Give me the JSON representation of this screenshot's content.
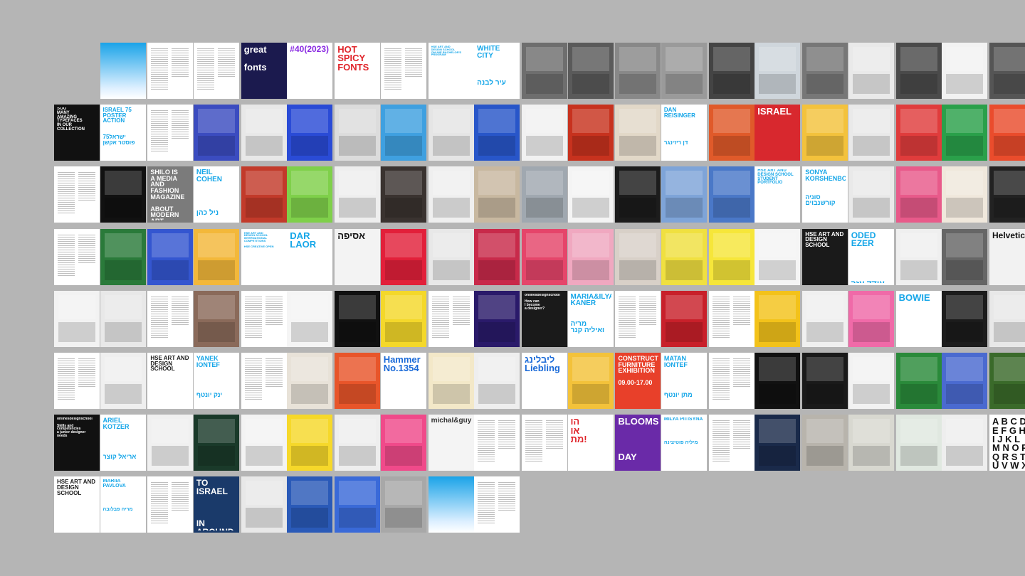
{
  "colors": {
    "background": "#b5b5b5",
    "accent": "#15a6e8",
    "paper": "#ffffff"
  },
  "pages": [
    {
      "id": "0-1",
      "row": 0,
      "col": 1,
      "kind": "blue-gradient"
    },
    {
      "id": "0-2",
      "row": 0,
      "col": 2,
      "kind": "text-spread"
    },
    {
      "id": "0-3",
      "row": 0,
      "col": 3,
      "kind": "text-spread"
    },
    {
      "id": "0-4",
      "row": 0,
      "col": 4,
      "kind": "cover",
      "bg": "#1b1a4e",
      "color": "#ffffff",
      "text": "great\n\nfonts"
    },
    {
      "id": "0-5",
      "row": 0,
      "col": 5,
      "kind": "title",
      "bg": "#ffffff",
      "color": "#8a2be2",
      "text": "#40(2023)"
    },
    {
      "id": "0-6",
      "row": 0,
      "col": 6,
      "kind": "title",
      "bg": "#ffffff",
      "color": "#e0242a",
      "text": "HOT\nSPICY\nFONTS"
    },
    {
      "id": "0-7",
      "row": 0,
      "col": 7,
      "kind": "text-spread"
    },
    {
      "id": "0-8",
      "row": 0,
      "col": 8,
      "kind": "title",
      "bg": "#ffffff",
      "color": "#15a6e8",
      "text": "HSE ART AND\nDESIGN SCHOOL\nONLINE BACHELOR'S PROGRAM"
    },
    {
      "id": "0-9",
      "row": 0,
      "col": 9,
      "kind": "title",
      "bg": "#ffffff",
      "color": "#15a6e8",
      "text": "WHITE CITY\n\n\n\nעיר לבנה"
    },
    {
      "id": "0-10",
      "row": 0,
      "col": 10,
      "kind": "photo",
      "bg": "#6e6e6e"
    },
    {
      "id": "0-11",
      "row": 0,
      "col": 11,
      "kind": "photo",
      "bg": "#5a5a5a"
    },
    {
      "id": "0-12",
      "row": 0,
      "col": 12,
      "kind": "photo",
      "bg": "#888888"
    },
    {
      "id": "0-13",
      "row": 0,
      "col": 13,
      "kind": "photo",
      "bg": "#9a9a9a"
    },
    {
      "id": "0-14",
      "row": 0,
      "col": 14,
      "kind": "photo",
      "bg": "#444444"
    },
    {
      "id": "0-15",
      "row": 0,
      "col": 15,
      "kind": "photo",
      "bg": "#cfd6dc"
    },
    {
      "id": "0-16",
      "row": 0,
      "col": 16,
      "kind": "photo",
      "bg": "#777777"
    },
    {
      "id": "0-17",
      "row": 0,
      "col": 17,
      "kind": "photo",
      "bg": "#e9e9e9"
    },
    {
      "id": "0-18",
      "row": 0,
      "col": 18,
      "kind": "photo",
      "bg": "#4a4a4a"
    },
    {
      "id": "0-19",
      "row": 0,
      "col": 19,
      "kind": "photo",
      "bg": "#f2f2f2"
    },
    {
      "id": "0-20",
      "row": 0,
      "col": 20,
      "kind": "photo",
      "bg": "#555555"
    },
    {
      "id": "1-0",
      "row": 1,
      "col": 0,
      "kind": "title",
      "bg": "#111111",
      "color": "#ffffff",
      "text": "SOO\nMANY\nAMAZING\nTYPEFACES\nIN OUR COLLECTION"
    },
    {
      "id": "1-1",
      "row": 1,
      "col": 1,
      "kind": "title",
      "bg": "#ffffff",
      "color": "#15a6e8",
      "text": "ISRAEL 75\nPOSTER ACTION\n\n\nישראל75\nפוסטר אקשן"
    },
    {
      "id": "1-2",
      "row": 1,
      "col": 2,
      "kind": "text-spread"
    },
    {
      "id": "1-3",
      "row": 1,
      "col": 3,
      "kind": "photo",
      "bg": "#3b4cc0"
    },
    {
      "id": "1-4",
      "row": 1,
      "col": 4,
      "kind": "photo",
      "bg": "#e8e8e8"
    },
    {
      "id": "1-5",
      "row": 1,
      "col": 5,
      "kind": "photo",
      "bg": "#2a4bd6"
    },
    {
      "id": "1-6",
      "row": 1,
      "col": 6,
      "kind": "photo",
      "bg": "#dcdcdc"
    },
    {
      "id": "1-7",
      "row": 1,
      "col": 7,
      "kind": "photo",
      "bg": "#3fa0e0"
    },
    {
      "id": "1-8",
      "row": 1,
      "col": 8,
      "kind": "photo",
      "bg": "#e5e5e5"
    },
    {
      "id": "1-9",
      "row": 1,
      "col": 9,
      "kind": "photo",
      "bg": "#2856c9"
    },
    {
      "id": "1-10",
      "row": 1,
      "col": 10,
      "kind": "photo",
      "bg": "#f1f1f1"
    },
    {
      "id": "1-11",
      "row": 1,
      "col": 11,
      "kind": "photo",
      "bg": "#c7321e"
    },
    {
      "id": "1-12",
      "row": 1,
      "col": 12,
      "kind": "photo",
      "bg": "#e2d8c8"
    },
    {
      "id": "1-13",
      "row": 1,
      "col": 13,
      "kind": "title",
      "bg": "#ffffff",
      "color": "#15a6e8",
      "text": "DAN REISINGER\n\n\n\n\nדן ריזינגר"
    },
    {
      "id": "1-14",
      "row": 1,
      "col": 14,
      "kind": "photo",
      "bg": "#e05a2a"
    },
    {
      "id": "1-15",
      "row": 1,
      "col": 15,
      "kind": "title",
      "bg": "#d8282e",
      "color": "#ffffff",
      "text": "ISRAEL"
    },
    {
      "id": "1-16",
      "row": 1,
      "col": 16,
      "kind": "photo",
      "bg": "#f3c23c"
    },
    {
      "id": "1-17",
      "row": 1,
      "col": 17,
      "kind": "photo",
      "bg": "#e9e9e9"
    },
    {
      "id": "1-18",
      "row": 1,
      "col": 18,
      "kind": "photo",
      "bg": "#e03c3c"
    },
    {
      "id": "1-19",
      "row": 1,
      "col": 19,
      "kind": "photo",
      "bg": "#2aa04a"
    },
    {
      "id": "1-20",
      "row": 1,
      "col": 20,
      "kind": "photo",
      "bg": "#ea4c2c"
    },
    {
      "id": "2-0",
      "row": 2,
      "col": 0,
      "kind": "text-spread"
    },
    {
      "id": "2-1",
      "row": 2,
      "col": 1,
      "kind": "photo",
      "bg": "#111111"
    },
    {
      "id": "2-2",
      "row": 2,
      "col": 2,
      "kind": "title",
      "bg": "#7b7b7b",
      "color": "#ffffff",
      "text": "SHILO IS\nA MEDIA AND\nFASHION\nMAGAZINE\n\nABOUT\nMODERN ART\nIN SAINT\nPETERSBURG"
    },
    {
      "id": "2-3",
      "row": 2,
      "col": 3,
      "kind": "title",
      "bg": "#ffffff",
      "color": "#15a6e8",
      "text": "NEIL COHEN\n\n\n\n\nניל כהן"
    },
    {
      "id": "2-4",
      "row": 2,
      "col": 4,
      "kind": "photo",
      "bg": "#c23a2a"
    },
    {
      "id": "2-5",
      "row": 2,
      "col": 5,
      "kind": "photo",
      "bg": "#7fd04a"
    },
    {
      "id": "2-6",
      "row": 2,
      "col": 6,
      "kind": "photo",
      "bg": "#eeeeee"
    },
    {
      "id": "2-7",
      "row": 2,
      "col": 7,
      "kind": "photo",
      "bg": "#3a3330"
    },
    {
      "id": "2-8",
      "row": 2,
      "col": 8,
      "kind": "photo",
      "bg": "#efefef"
    },
    {
      "id": "2-9",
      "row": 2,
      "col": 9,
      "kind": "photo",
      "bg": "#c8b8a0"
    },
    {
      "id": "2-10",
      "row": 2,
      "col": 10,
      "kind": "photo",
      "bg": "#a0a8b0"
    },
    {
      "id": "2-11",
      "row": 2,
      "col": 11,
      "kind": "photo",
      "bg": "#f4f4f4"
    },
    {
      "id": "2-12",
      "row": 2,
      "col": 12,
      "kind": "photo",
      "bg": "#1c1c1c"
    },
    {
      "id": "2-13",
      "row": 2,
      "col": 13,
      "kind": "photo",
      "bg": "#7ea4d8"
    },
    {
      "id": "2-14",
      "row": 2,
      "col": 14,
      "kind": "photo",
      "bg": "#4a78c8"
    },
    {
      "id": "2-15",
      "row": 2,
      "col": 15,
      "kind": "title",
      "bg": "#ffffff",
      "color": "#15a6e8",
      "text": "HSE ART AND\nDESIGN SCHOOL\nSTUDENT PORTFOLIO"
    },
    {
      "id": "2-16",
      "row": 2,
      "col": 16,
      "kind": "title",
      "bg": "#ffffff",
      "color": "#15a6e8",
      "text": "SONYA\nKORSHENBOYM\n\n\nסוניה\nקורשנבוים"
    },
    {
      "id": "2-17",
      "row": 2,
      "col": 17,
      "kind": "photo",
      "bg": "#e9e9e9"
    },
    {
      "id": "2-18",
      "row": 2,
      "col": 18,
      "kind": "photo",
      "bg": "#e85a8a"
    },
    {
      "id": "2-19",
      "row": 2,
      "col": 19,
      "kind": "photo",
      "bg": "#f0e8dc"
    },
    {
      "id": "2-20",
      "row": 2,
      "col": 20,
      "kind": "photo",
      "bg": "#222222"
    },
    {
      "id": "3-0",
      "row": 3,
      "col": 0,
      "kind": "text-spread"
    },
    {
      "id": "3-1",
      "row": 3,
      "col": 1,
      "kind": "photo",
      "bg": "#2a7a3a"
    },
    {
      "id": "3-2",
      "row": 3,
      "col": 2,
      "kind": "photo",
      "bg": "#3456d0"
    },
    {
      "id": "3-3",
      "row": 3,
      "col": 3,
      "kind": "photo",
      "bg": "#f3b83a"
    },
    {
      "id": "3-4",
      "row": 3,
      "col": 4,
      "kind": "title",
      "bg": "#ffffff",
      "color": "#15a6e8",
      "text": "HSE ART AND\nDESIGN SCHOOL\nINTERNATIONAL COMPETITIONS\n\nHSE CREATIVE OPEN"
    },
    {
      "id": "3-5",
      "row": 3,
      "col": 5,
      "kind": "title",
      "bg": "#ffffff",
      "color": "#15a6e8",
      "text": "DAR LAOR\n\n\n\n\nדר לאור"
    },
    {
      "id": "3-6",
      "row": 3,
      "col": 6,
      "kind": "title",
      "bg": "#f3f3f3",
      "color": "#111111",
      "text": "אסיפה"
    },
    {
      "id": "3-7",
      "row": 3,
      "col": 7,
      "kind": "photo",
      "bg": "#e2203a"
    },
    {
      "id": "3-8",
      "row": 3,
      "col": 8,
      "kind": "photo",
      "bg": "#e8e8e8"
    },
    {
      "id": "3-9",
      "row": 3,
      "col": 9,
      "kind": "photo",
      "bg": "#c82a4a"
    },
    {
      "id": "3-10",
      "row": 3,
      "col": 10,
      "kind": "photo",
      "bg": "#e5456a"
    },
    {
      "id": "3-11",
      "row": 3,
      "col": 11,
      "kind": "photo",
      "bg": "#f0a8c0"
    },
    {
      "id": "3-12",
      "row": 3,
      "col": 12,
      "kind": "photo",
      "bg": "#d8d0c8"
    },
    {
      "id": "3-13",
      "row": 3,
      "col": 13,
      "kind": "photo",
      "bg": "#f0e040"
    },
    {
      "id": "3-14",
      "row": 3,
      "col": 14,
      "kind": "photo",
      "bg": "#f6e63a"
    },
    {
      "id": "3-15",
      "row": 3,
      "col": 15,
      "kind": "photo",
      "bg": "#f5f5f5"
    },
    {
      "id": "3-16",
      "row": 3,
      "col": 16,
      "kind": "title",
      "bg": "#1a1a1a",
      "color": "#ffffff",
      "text": "HSE ART AND\nDESIGN SCHOOL"
    },
    {
      "id": "3-17",
      "row": 3,
      "col": 17,
      "kind": "title",
      "bg": "#ffffff",
      "color": "#15a6e8",
      "text": "ODED EZER\n\n\n\n\nעודד עזר"
    },
    {
      "id": "3-18",
      "row": 3,
      "col": 18,
      "kind": "photo",
      "bg": "#efefef"
    },
    {
      "id": "3-19",
      "row": 3,
      "col": 19,
      "kind": "photo",
      "bg": "#666666"
    },
    {
      "id": "3-20",
      "row": 3,
      "col": 20,
      "kind": "title",
      "bg": "#f2f2f2",
      "color": "#111111",
      "text": "Helvetica"
    },
    {
      "id": "4-0",
      "row": 4,
      "col": 0,
      "kind": "photo",
      "bg": "#f2f2f2"
    },
    {
      "id": "4-1",
      "row": 4,
      "col": 1,
      "kind": "photo",
      "bg": "#e8e8e8"
    },
    {
      "id": "4-2",
      "row": 4,
      "col": 2,
      "kind": "text-spread"
    },
    {
      "id": "4-3",
      "row": 4,
      "col": 3,
      "kind": "photo",
      "bg": "#8a6a5a"
    },
    {
      "id": "4-4",
      "row": 4,
      "col": 4,
      "kind": "text-spread"
    },
    {
      "id": "4-5",
      "row": 4,
      "col": 5,
      "kind": "photo",
      "bg": "#f5f5f5"
    },
    {
      "id": "4-6",
      "row": 4,
      "col": 6,
      "kind": "photo",
      "bg": "#111111"
    },
    {
      "id": "4-7",
      "row": 4,
      "col": 7,
      "kind": "photo",
      "bg": "#f4d82a"
    },
    {
      "id": "4-8",
      "row": 4,
      "col": 8,
      "kind": "text-spread"
    },
    {
      "id": "4-9",
      "row": 4,
      "col": 9,
      "kind": "photo",
      "bg": "#2a1a6a"
    },
    {
      "id": "4-10",
      "row": 4,
      "col": 10,
      "kind": "title",
      "bg": "#1a1a1a",
      "color": "#ffffff",
      "text": "onlinesdesignschool\n\nHow can\nI become\na designer?"
    },
    {
      "id": "4-11",
      "row": 4,
      "col": 11,
      "kind": "title",
      "bg": "#ffffff",
      "color": "#15a6e8",
      "text": "MARIA&ILYA\nKANER\n\n\nמריה\nואיליה קנר"
    },
    {
      "id": "4-12",
      "row": 4,
      "col": 12,
      "kind": "text-spread"
    },
    {
      "id": "4-13",
      "row": 4,
      "col": 13,
      "kind": "photo",
      "bg": "#c8202a"
    },
    {
      "id": "4-14",
      "row": 4,
      "col": 14,
      "kind": "text-spread"
    },
    {
      "id": "4-15",
      "row": 4,
      "col": 15,
      "kind": "photo",
      "bg": "#f3c21a"
    },
    {
      "id": "4-16",
      "row": 4,
      "col": 16,
      "kind": "photo",
      "bg": "#f0f0f0"
    },
    {
      "id": "4-17",
      "row": 4,
      "col": 17,
      "kind": "photo",
      "bg": "#f06aa8"
    },
    {
      "id": "4-18",
      "row": 4,
      "col": 18,
      "kind": "title",
      "bg": "#ffffff",
      "color": "#15a6e8",
      "text": "BOWIE"
    },
    {
      "id": "4-19",
      "row": 4,
      "col": 19,
      "kind": "photo",
      "bg": "#1c1c1c"
    },
    {
      "id": "4-20",
      "row": 4,
      "col": 20,
      "kind": "photo",
      "bg": "#e8e8e8"
    },
    {
      "id": "5-0",
      "row": 5,
      "col": 0,
      "kind": "text-spread"
    },
    {
      "id": "5-1",
      "row": 5,
      "col": 1,
      "kind": "photo",
      "bg": "#efefef"
    },
    {
      "id": "5-2",
      "row": 5,
      "col": 2,
      "kind": "title",
      "bg": "#ffffff",
      "color": "#1a1a1a",
      "text": "HSE ART AND\nDESIGN SCHOOL"
    },
    {
      "id": "5-3",
      "row": 5,
      "col": 3,
      "kind": "title",
      "bg": "#ffffff",
      "color": "#15a6e8",
      "text": "YANEK IONTEF\n\n\n\n\nינק יונטף"
    },
    {
      "id": "5-4",
      "row": 5,
      "col": 4,
      "kind": "text-spread"
    },
    {
      "id": "5-5",
      "row": 5,
      "col": 5,
      "kind": "photo",
      "bg": "#e8e2d8"
    },
    {
      "id": "5-6",
      "row": 5,
      "col": 6,
      "kind": "photo",
      "bg": "#e8552a"
    },
    {
      "id": "5-7",
      "row": 5,
      "col": 7,
      "kind": "title",
      "bg": "#ffffff",
      "color": "#1a6ad8",
      "text": "Hammer\nNo.1354"
    },
    {
      "id": "5-8",
      "row": 5,
      "col": 8,
      "kind": "photo",
      "bg": "#f3e8c8"
    },
    {
      "id": "5-9",
      "row": 5,
      "col": 9,
      "kind": "photo",
      "bg": "#eeeeee"
    },
    {
      "id": "5-10",
      "row": 5,
      "col": 10,
      "kind": "title",
      "bg": "#ffffff",
      "color": "#1a6ad8",
      "text": "ליבלינג\nLiebling"
    },
    {
      "id": "5-11",
      "row": 5,
      "col": 11,
      "kind": "photo",
      "bg": "#f3c23a"
    },
    {
      "id": "5-12",
      "row": 5,
      "col": 12,
      "kind": "title",
      "bg": "#e8402a",
      "color": "#ffffff",
      "text": "CONSTRUCT\nFURNITURE\nEXHIBITION\n\n09.00-17.00"
    },
    {
      "id": "5-13",
      "row": 5,
      "col": 13,
      "kind": "title",
      "bg": "#ffffff",
      "color": "#15a6e8",
      "text": "MATAN IONTEF\n\n\n\n\nמתן יונטף"
    },
    {
      "id": "5-14",
      "row": 5,
      "col": 14,
      "kind": "text-spread"
    },
    {
      "id": "5-15",
      "row": 5,
      "col": 15,
      "kind": "photo",
      "bg": "#111111"
    },
    {
      "id": "5-16",
      "row": 5,
      "col": 16,
      "kind": "photo",
      "bg": "#1a1a1a"
    },
    {
      "id": "5-17",
      "row": 5,
      "col": 17,
      "kind": "photo",
      "bg": "#f2f2f2"
    },
    {
      "id": "5-18",
      "row": 5,
      "col": 18,
      "kind": "photo",
      "bg": "#2a8a3a"
    },
    {
      "id": "5-19",
      "row": 5,
      "col": 19,
      "kind": "photo",
      "bg": "#4a6ad0"
    },
    {
      "id": "5-20",
      "row": 5,
      "col": 20,
      "kind": "photo",
      "bg": "#3a6a2a"
    },
    {
      "id": "6-0",
      "row": 6,
      "col": 0,
      "kind": "title",
      "bg": "#111111",
      "color": "#ffffff",
      "text": "onlinesdesignschool\n\nSkills and\ncompetencies\na junior designer\nneeds"
    },
    {
      "id": "6-1",
      "row": 6,
      "col": 1,
      "kind": "title",
      "bg": "#ffffff",
      "color": "#15a6e8",
      "text": "ARIEL KOTZER\n\n\n\n\nאריאל קוצר"
    },
    {
      "id": "6-2",
      "row": 6,
      "col": 2,
      "kind": "photo",
      "bg": "#f0f0f0"
    },
    {
      "id": "6-3",
      "row": 6,
      "col": 3,
      "kind": "photo",
      "bg": "#1a3a2a"
    },
    {
      "id": "6-4",
      "row": 6,
      "col": 4,
      "kind": "photo",
      "bg": "#f3f3f3"
    },
    {
      "id": "6-5",
      "row": 6,
      "col": 5,
      "kind": "photo",
      "bg": "#f6d82a"
    },
    {
      "id": "6-6",
      "row": 6,
      "col": 6,
      "kind": "photo",
      "bg": "#eeeeee"
    },
    {
      "id": "6-7",
      "row": 6,
      "col": 7,
      "kind": "photo",
      "bg": "#f04a8a"
    },
    {
      "id": "6-8",
      "row": 6,
      "col": 8,
      "kind": "title",
      "bg": "#f4f4f4",
      "color": "#333333",
      "text": "michal&guy"
    },
    {
      "id": "6-9",
      "row": 6,
      "col": 9,
      "kind": "text-spread"
    },
    {
      "id": "6-10",
      "row": 6,
      "col": 10,
      "kind": "text-spread"
    },
    {
      "id": "6-11",
      "row": 6,
      "col": 11,
      "kind": "title",
      "bg": "#ffffff",
      "color": "#e0242a",
      "text": "הו\nאו\nמת!"
    },
    {
      "id": "6-12",
      "row": 6,
      "col": 12,
      "kind": "title",
      "bg": "#6a2aa8",
      "color": "#ffffff",
      "text": "BLOOMS\n\n\n\nDAY"
    },
    {
      "id": "6-13",
      "row": 6,
      "col": 13,
      "kind": "title",
      "bg": "#ffffff",
      "color": "#15a6e8",
      "text": "MILYA PITISYNA\n\n\n\n\nמיליה פוטיצינה"
    },
    {
      "id": "6-14",
      "row": 6,
      "col": 14,
      "kind": "text-spread"
    },
    {
      "id": "6-15",
      "row": 6,
      "col": 15,
      "kind": "photo",
      "bg": "#1a2a4a"
    },
    {
      "id": "6-16",
      "row": 6,
      "col": 16,
      "kind": "photo",
      "bg": "#b8b4ac"
    },
    {
      "id": "6-17",
      "row": 6,
      "col": 17,
      "kind": "photo",
      "bg": "#d8d8d0"
    },
    {
      "id": "6-18",
      "row": 6,
      "col": 18,
      "kind": "photo",
      "bg": "#e0e8e0"
    },
    {
      "id": "6-19",
      "row": 6,
      "col": 19,
      "kind": "photo",
      "bg": "#eeeeee"
    },
    {
      "id": "6-20",
      "row": 6,
      "col": 20,
      "kind": "title",
      "bg": "#ffffff",
      "color": "#111111",
      "text": "A B C D\nE F G H\nI J K L\nM N O P\nQ R S T\nU V W X\nY Z"
    },
    {
      "id": "7-0",
      "row": 7,
      "col": 0,
      "kind": "title",
      "bg": "#ffffff",
      "color": "#1a1a1a",
      "text": "HSE ART AND\nDESIGN SCHOOL"
    },
    {
      "id": "7-1",
      "row": 7,
      "col": 1,
      "kind": "title",
      "bg": "#ffffff",
      "color": "#15a6e8",
      "text": "MARIIA PAVLOVA\n\n\n\n\nמריה פבלובה"
    },
    {
      "id": "7-2",
      "row": 7,
      "col": 2,
      "kind": "text-spread"
    },
    {
      "id": "7-3",
      "row": 7,
      "col": 3,
      "kind": "title",
      "bg": "#1a3a6a",
      "color": "#ffffff",
      "text": "TO ISRAEL\n\n\n\nIN AROUND"
    },
    {
      "id": "7-4",
      "row": 7,
      "col": 4,
      "kind": "photo",
      "bg": "#e8e8e8"
    },
    {
      "id": "7-5",
      "row": 7,
      "col": 5,
      "kind": "photo",
      "bg": "#2a5ab8"
    },
    {
      "id": "7-6",
      "row": 7,
      "col": 6,
      "kind": "photo",
      "bg": "#3a6ad8"
    },
    {
      "id": "7-7",
      "row": 7,
      "col": 7,
      "kind": "photo",
      "bg": "#a8a8a8"
    },
    {
      "id": "7-8",
      "row": 7,
      "col": 8,
      "kind": "blue-gradient"
    },
    {
      "id": "7-9",
      "row": 7,
      "col": 9,
      "kind": "text-spread"
    }
  ]
}
